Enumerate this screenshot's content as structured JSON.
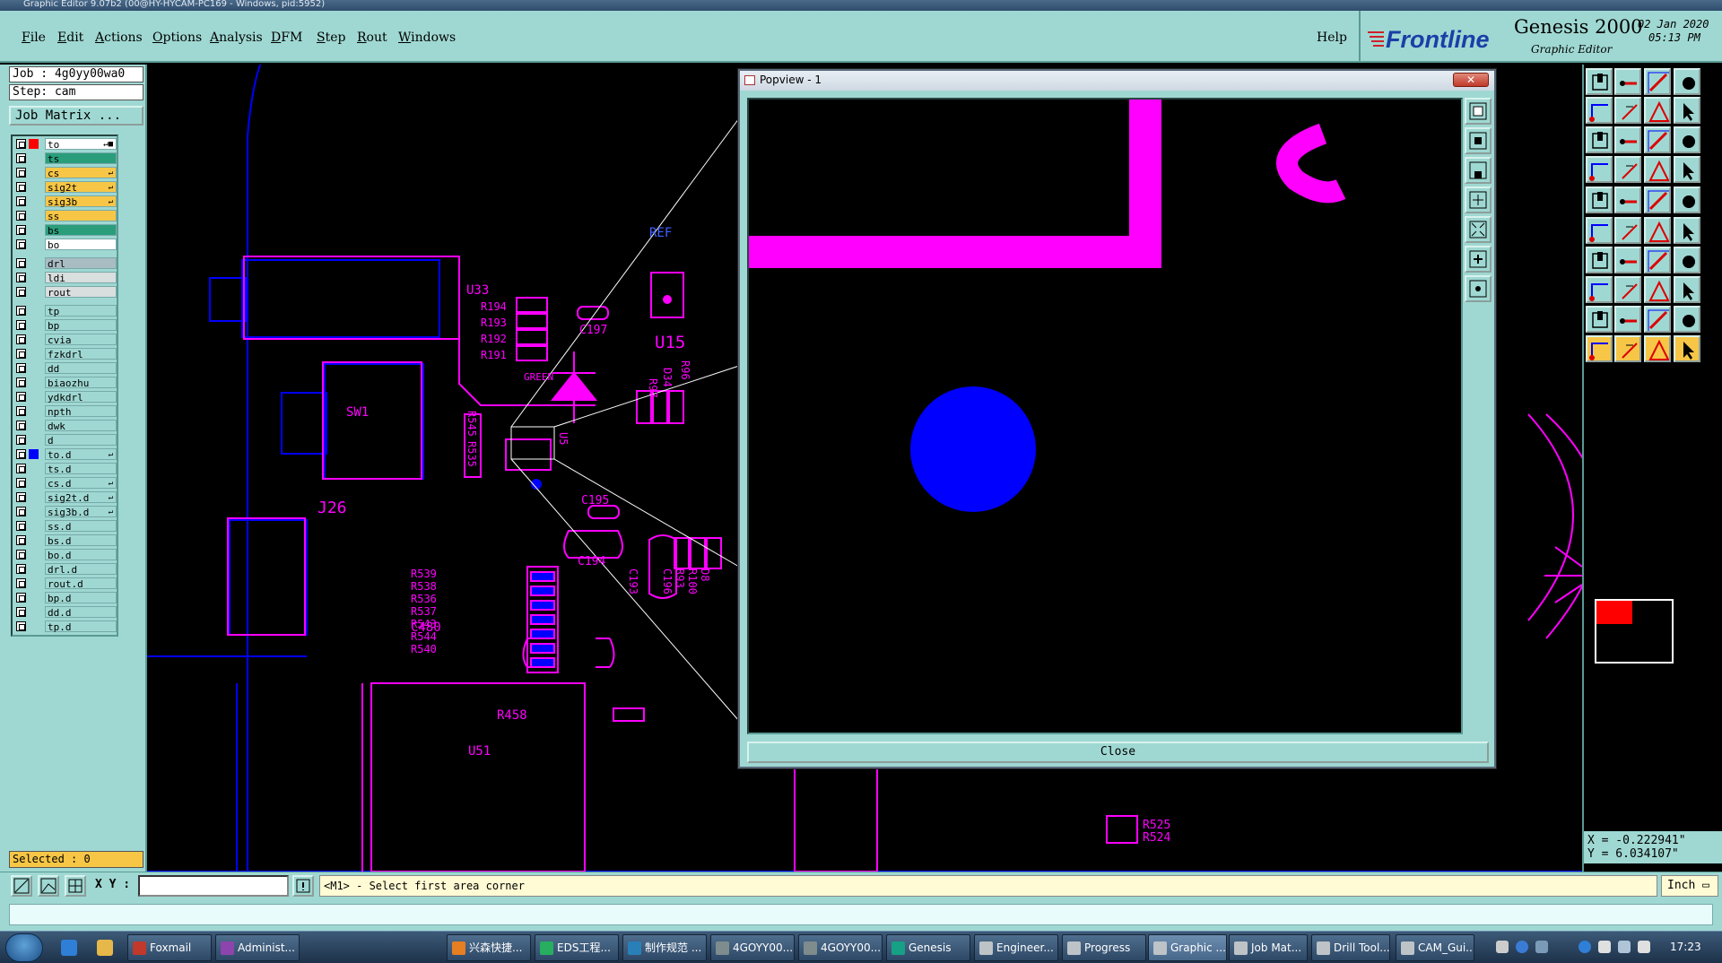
{
  "window": {
    "title": "Graphic Editor 9.07b2 (00@HY-HYCAM-PC169 - Windows, pid:5952)"
  },
  "menu": {
    "items": [
      {
        "label": "File",
        "ul": "F",
        "rest": "ile"
      },
      {
        "label": "Edit",
        "ul": "E",
        "rest": "dit"
      },
      {
        "label": "Actions",
        "ul": "A",
        "rest": "ctions"
      },
      {
        "label": "Options",
        "ul": "O",
        "rest": "ptions"
      },
      {
        "label": "Analysis",
        "ul": "A",
        "rest": "nalysis"
      },
      {
        "label": "DFM",
        "ul": "D",
        "rest": "FM"
      },
      {
        "label": "Step",
        "ul": "S",
        "rest": "tep"
      },
      {
        "label": "Rout",
        "ul": "R",
        "rest": "out"
      },
      {
        "label": "Windows",
        "ul": "W",
        "rest": "indows"
      }
    ],
    "help": "Help"
  },
  "brand": {
    "logo_text": "Frontline",
    "product": "Genesis 2000",
    "subtitle": "Graphic Editor",
    "date": "02 Jan 2020",
    "time": "05:13 PM"
  },
  "job": {
    "job_line": "Job : 4g0yy00wa0",
    "step_line": "Step: cam",
    "matrix_button": "Job Matrix ..."
  },
  "layers": [
    {
      "name": "to",
      "color": "#ffffff",
      "dot": "#ff0000",
      "arrow": "↵■"
    },
    {
      "name": "ts",
      "color": "#2a9e7a",
      "dot": "",
      "arrow": ""
    },
    {
      "name": "cs",
      "color": "#f7c646",
      "dot": "",
      "arrow": "↵"
    },
    {
      "name": "sig2t",
      "color": "#f7c646",
      "dot": "",
      "arrow": "↵"
    },
    {
      "name": "sig3b",
      "color": "#f7c646",
      "dot": "",
      "arrow": "↵"
    },
    {
      "name": "ss",
      "color": "#f7c646",
      "dot": "",
      "arrow": ""
    },
    {
      "name": "bs",
      "color": "#2a9e7a",
      "dot": "",
      "arrow": ""
    },
    {
      "name": "bo",
      "color": "#ffffff",
      "dot": "",
      "arrow": ""
    },
    {
      "name": "drl",
      "color": "#a9bcc2",
      "dot": "",
      "arrow": ""
    },
    {
      "name": "ldi",
      "color": "#d9dede",
      "dot": "",
      "arrow": ""
    },
    {
      "name": "rout",
      "color": "#d9dede",
      "dot": "",
      "arrow": ""
    },
    {
      "name": "tp",
      "color": "#9fd8d2",
      "dot": "",
      "arrow": ""
    },
    {
      "name": "bp",
      "color": "#9fd8d2",
      "dot": "",
      "arrow": ""
    },
    {
      "name": "cvia",
      "color": "#9fd8d2",
      "dot": "",
      "arrow": ""
    },
    {
      "name": "fzkdrl",
      "color": "#9fd8d2",
      "dot": "",
      "arrow": ""
    },
    {
      "name": "dd",
      "color": "#9fd8d2",
      "dot": "",
      "arrow": ""
    },
    {
      "name": "biaozhu",
      "color": "#9fd8d2",
      "dot": "",
      "arrow": ""
    },
    {
      "name": "ydkdrl",
      "color": "#9fd8d2",
      "dot": "",
      "arrow": ""
    },
    {
      "name": "npth",
      "color": "#9fd8d2",
      "dot": "",
      "arrow": ""
    },
    {
      "name": "dwk",
      "color": "#9fd8d2",
      "dot": "",
      "arrow": ""
    },
    {
      "name": "d",
      "color": "#9fd8d2",
      "dot": "",
      "arrow": ""
    },
    {
      "name": "to.d",
      "color": "#9fd8d2",
      "dot": "#0000ff",
      "arrow": "↵"
    },
    {
      "name": "ts.d",
      "color": "#9fd8d2",
      "dot": "",
      "arrow": ""
    },
    {
      "name": "cs.d",
      "color": "#9fd8d2",
      "dot": "",
      "arrow": "↵"
    },
    {
      "name": "sig2t.d",
      "color": "#9fd8d2",
      "dot": "",
      "arrow": "↵"
    },
    {
      "name": "sig3b.d",
      "color": "#9fd8d2",
      "dot": "",
      "arrow": "↵"
    },
    {
      "name": "ss.d",
      "color": "#9fd8d2",
      "dot": "",
      "arrow": ""
    },
    {
      "name": "bs.d",
      "color": "#9fd8d2",
      "dot": "",
      "arrow": ""
    },
    {
      "name": "bo.d",
      "color": "#9fd8d2",
      "dot": "",
      "arrow": ""
    },
    {
      "name": "drl.d",
      "color": "#9fd8d2",
      "dot": "",
      "arrow": ""
    },
    {
      "name": "rout.d",
      "color": "#9fd8d2",
      "dot": "",
      "arrow": ""
    },
    {
      "name": "bp.d",
      "color": "#9fd8d2",
      "dot": "",
      "arrow": ""
    },
    {
      "name": "dd.d",
      "color": "#9fd8d2",
      "dot": "",
      "arrow": ""
    },
    {
      "name": "tp.d",
      "color": "#9fd8d2",
      "dot": "",
      "arrow": ""
    }
  ],
  "selected": "Selected : 0",
  "canvas_labels": {
    "ref": "REF",
    "u33": "U33",
    "r194": "R194",
    "r193": "R193",
    "r192": "R192",
    "r191": "R191",
    "c197": "C197",
    "u15": "U15",
    "green": "GREEN",
    "sw1": "SW1",
    "r97": "R97",
    "d34": "D34",
    "r96": "R96",
    "r545": "R545",
    "r535": "R535",
    "u5": "U5",
    "j26": "J26",
    "c195": "C195",
    "c194": "C194",
    "c193": "C193",
    "r539": "R539",
    "r538": "R538",
    "r536": "R536",
    "r537": "R537",
    "r543": "R543",
    "r544": "R544",
    "r540": "R540",
    "c480": "C480",
    "r458": "R458",
    "u51": "U51",
    "r525": "R525",
    "r524": "R524",
    "c196": "C196",
    "r93": "R93",
    "r100": "R100",
    "d8": "D8"
  },
  "colors": {
    "magenta": "#ff00ff",
    "blue": "#0000ff",
    "panel": "#9fd8d2"
  },
  "popview": {
    "title": "Popview - 1",
    "close_button": "Close"
  },
  "coords": {
    "x": "X = -0.222941\"",
    "y": "Y = 6.034107\""
  },
  "bottom": {
    "xy_label": "X Y :",
    "xy_value": "",
    "prompt": "<M1> - Select first area corner",
    "units": "Inch"
  },
  "taskbar": {
    "items": [
      {
        "label": "Foxmail",
        "color": "#c0392b"
      },
      {
        "label": "Administ...",
        "color": "#8e44ad"
      },
      {
        "label": "兴森快捷...",
        "color": "#e67e22"
      },
      {
        "label": "EDS工程...",
        "color": "#27ae60"
      },
      {
        "label": "制作规范 ...",
        "color": "#2980b9"
      },
      {
        "label": "4GOYY00...",
        "color": "#7f8c8d"
      },
      {
        "label": "4GOYY00...",
        "color": "#7f8c8d"
      },
      {
        "label": "Genesis",
        "color": "#16a085"
      },
      {
        "label": "Engineer...",
        "color": "#bdc3c7"
      },
      {
        "label": "Progress",
        "color": "#bdc3c7"
      },
      {
        "label": "Graphic ...",
        "color": "#bdc3c7"
      },
      {
        "label": "Job Mat...",
        "color": "#bdc3c7"
      },
      {
        "label": "Drill Tool...",
        "color": "#bdc3c7"
      },
      {
        "label": "CAM_Gui...",
        "color": "#bdc3c7"
      }
    ],
    "clock": "17:23"
  }
}
